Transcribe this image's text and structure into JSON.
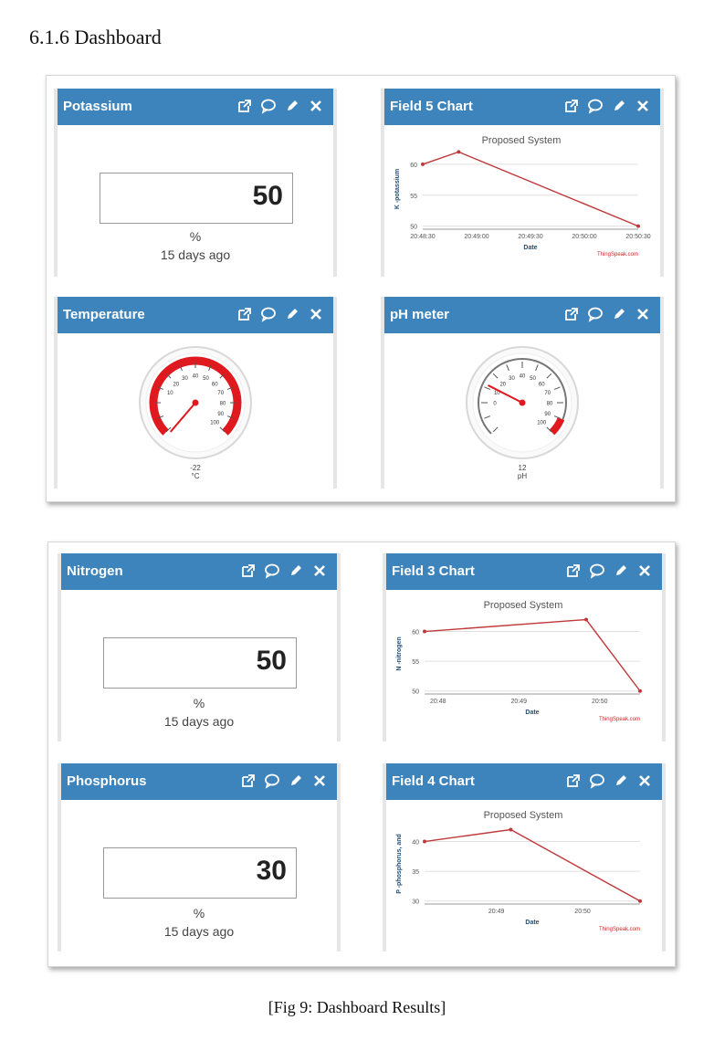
{
  "heading": "6.1.6  Dashboard",
  "caption": "[Fig 9: Dashboard Results]",
  "widgets": {
    "potassium": {
      "title": "Potassium",
      "value": "50",
      "unit": "%",
      "ago": "15 days ago"
    },
    "field5": {
      "title": "Field 5 Chart"
    },
    "temperature": {
      "title": "Temperature",
      "value": "-22",
      "unit": "°C"
    },
    "ph": {
      "title": "pH meter",
      "value": "12",
      "unit": "pH"
    },
    "nitrogen": {
      "title": "Nitrogen",
      "value": "50",
      "unit": "%",
      "ago": "15 days ago"
    },
    "field3": {
      "title": "Field 3 Chart"
    },
    "phosphorus": {
      "title": "Phosphorus",
      "value": "30",
      "unit": "%",
      "ago": "15 days ago"
    },
    "field4": {
      "title": "Field 4 Chart"
    }
  },
  "icons": [
    "external-link-icon",
    "comment-icon",
    "pencil-icon",
    "close-icon"
  ],
  "colors": {
    "header": "#3e84bc",
    "series": "#c0393b",
    "gauge_red": "#e0191e",
    "credit": "#d22222",
    "axis_title": "#1f4e79"
  },
  "chart_data": [
    {
      "type": "line",
      "title": "Proposed System",
      "xlabel": "Date",
      "ylabel": "K -potassium",
      "x": [
        "20:48:30",
        "20:48:50",
        "20:50:30"
      ],
      "values": [
        60,
        62,
        50
      ],
      "xticks": [
        "20:48:30",
        "20:49:00",
        "20:49:30",
        "20:50:00",
        "20:50:30"
      ],
      "xrange": [
        0,
        120
      ],
      "xpos": [
        0,
        20,
        120
      ],
      "yticks": [
        50,
        55,
        60
      ],
      "ylim": [
        49.5,
        62.5
      ],
      "credit": "ThingSpeak.com"
    },
    {
      "type": "line",
      "title": "Proposed System",
      "xlabel": "Date",
      "ylabel": "N -nitrogen",
      "x": [
        "20:47:50",
        "20:49:50",
        "20:50:30"
      ],
      "values": [
        60,
        62,
        50
      ],
      "xticks": [
        "20:48",
        "20:49",
        "20:50"
      ],
      "xrange": [
        0,
        160
      ],
      "xpos": [
        0,
        120,
        160
      ],
      "xtickpos": [
        10,
        70,
        130
      ],
      "yticks": [
        50,
        55,
        60
      ],
      "ylim": [
        49.5,
        63
      ],
      "credit": "ThingSpeak.com"
    },
    {
      "type": "line",
      "title": "Proposed System",
      "xlabel": "Date",
      "ylabel": "P -phosphorus, and",
      "x": [
        "20:48:30",
        "20:49:30",
        "20:51:00"
      ],
      "values": [
        40,
        42,
        30
      ],
      "xticks": [
        "20:49",
        "20:50"
      ],
      "xrange": [
        0,
        150
      ],
      "xpos": [
        0,
        60,
        150
      ],
      "xtickpos": [
        50,
        110
      ],
      "yticks": [
        30,
        35,
        40
      ],
      "ylim": [
        29.5,
        43
      ],
      "credit": "ThingSpeak.com"
    }
  ],
  "gauges": [
    {
      "name": "temperature",
      "min": -20,
      "max": 100,
      "value": -22,
      "labels": [
        "10",
        "20",
        "30",
        "40",
        "50",
        "60",
        "70",
        "80",
        "90",
        "100"
      ],
      "redFrom": -20,
      "redTo": 100,
      "fullRed": true
    },
    {
      "name": "ph",
      "min": -20,
      "max": 100,
      "value": 12,
      "labels": [
        "0",
        "10",
        "20",
        "30",
        "40",
        "50",
        "60",
        "70",
        "80",
        "90",
        "100"
      ],
      "redFrom": 90,
      "redTo": 100,
      "fullRed": false
    }
  ]
}
